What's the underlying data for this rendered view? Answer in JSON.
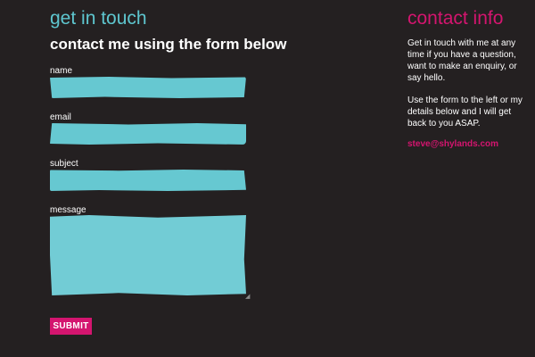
{
  "contact_form": {
    "section_title": "get in touch",
    "heading": "contact me using the form below",
    "fields": {
      "name": {
        "label": "name",
        "value": ""
      },
      "email": {
        "label": "email",
        "value": ""
      },
      "subject": {
        "label": "subject",
        "value": ""
      },
      "message": {
        "label": "message",
        "value": ""
      }
    },
    "submit_label": "SUBMIT"
  },
  "contact_info": {
    "title": "contact info",
    "paragraph_1": "Get in touch with me at any time if you have a question, want to make an enquiry, or say hello.",
    "paragraph_2": "Use the form to the left or my details below and I will get back to you ASAP.",
    "email": "steve@shylands.com"
  },
  "colors": {
    "background": "#242021",
    "accent_cyan": "#5ec6cf",
    "accent_pink": "#d4156f",
    "field_fill": "#66c8d1",
    "text": "#ffffff"
  }
}
